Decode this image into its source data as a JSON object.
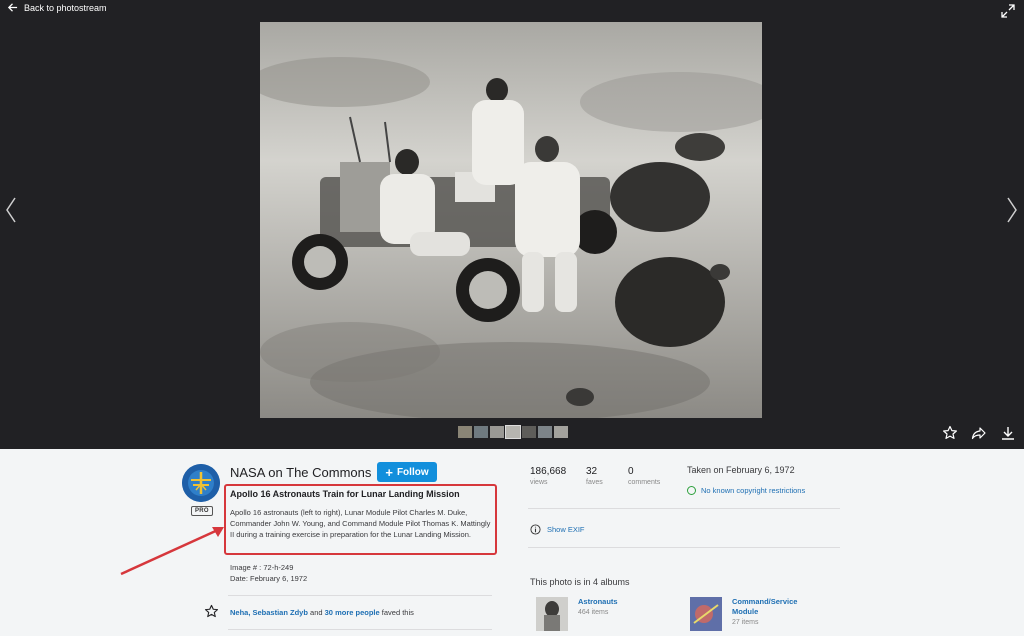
{
  "viewer": {
    "back_label": "Back to photostream",
    "filmstrip_count": 7
  },
  "owner": {
    "name": "NASA on The Commons",
    "badge": "PRO",
    "follow_label": "Follow"
  },
  "photo": {
    "title": "Apollo 16 Astronauts Train for Lunar Landing Mission",
    "description": "Apollo 16 astronauts (left to right), Lunar Module Pilot Charles M. Duke, Commander John W. Young, and Command Module Pilot Thomas K. Mattingly II during a training exercise in preparation for the Lunar Landing Mission.",
    "image_number": "Image # : 72-h-249",
    "date_line": "Date: February 6, 1972"
  },
  "faves": {
    "names": "Neha, Sebastian Zdyb",
    "connector": "and",
    "more": "30 more people",
    "suffix": "faved this"
  },
  "stats": {
    "views": {
      "value": "186,668",
      "label": "views"
    },
    "faves": {
      "value": "32",
      "label": "faves"
    },
    "comments": {
      "value": "0",
      "label": "comments"
    }
  },
  "taken_on": "Taken on February 6, 1972",
  "copyright": "No known copyright restrictions",
  "exif_label": "Show EXIF",
  "albums": {
    "heading": "This photo is in 4 albums",
    "items": [
      {
        "title": "Astronauts",
        "count": "464 items"
      },
      {
        "title": "Command/Service Module",
        "count": "27 items"
      }
    ]
  },
  "colors": {
    "viewer_bg": "#212124",
    "follow_blue": "#128fdc",
    "link_blue": "#1e6fb3",
    "highlight_red": "#d6373c",
    "copyright_green": "#2ca03c"
  },
  "icons": [
    "back-arrow-icon",
    "expand-icon",
    "chevron-left-icon",
    "chevron-right-icon",
    "star-icon",
    "share-icon",
    "download-icon",
    "info-icon",
    "plus-icon"
  ]
}
